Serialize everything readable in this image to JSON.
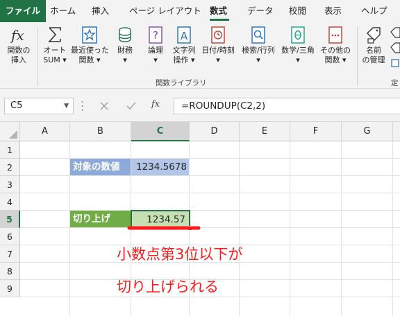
{
  "tabs": [
    "ファイル",
    "ホーム",
    "挿入",
    "ページ レイアウト",
    "数式",
    "データ",
    "校閲",
    "表示",
    "ヘルプ"
  ],
  "active_tab": "数式",
  "ribbon": {
    "buttons": [
      {
        "line1": "関数の",
        "line2": "挿入",
        "icon": "fx-icon"
      },
      {
        "line1": "オート",
        "line2": "SUM ▾",
        "icon": "sigma-icon"
      },
      {
        "line1": "最近使った",
        "line2": "関数 ▾",
        "icon": "star-icon"
      },
      {
        "line1": "財務",
        "line2": "▾",
        "icon": "coins-icon"
      },
      {
        "line1": "論理",
        "line2": "▾",
        "icon": "question-book-icon"
      },
      {
        "line1": "文字列",
        "line2": "操作 ▾",
        "icon": "text-book-icon"
      },
      {
        "line1": "日付/時刻",
        "line2": "▾",
        "icon": "clock-book-icon"
      },
      {
        "line1": "検索/行列",
        "line2": "▾",
        "icon": "search-book-icon"
      },
      {
        "line1": "数学/三角",
        "line2": "▾",
        "icon": "theta-book-icon"
      },
      {
        "line1": "その他の",
        "line2": "関数 ▾",
        "icon": "more-book-icon"
      },
      {
        "line1": "名前",
        "line2": "の管理",
        "icon": "name-tag-icon"
      }
    ],
    "group_label": "関数ライブラリ",
    "group_label_right": "定"
  },
  "formula_bar": {
    "name_box": "C5",
    "fx_label": "fx",
    "formula": "=ROUNDUP(C2,2)"
  },
  "columns": [
    "A",
    "B",
    "C",
    "D",
    "E",
    "F",
    "G"
  ],
  "selected_column": "C",
  "rows": [
    "1",
    "2",
    "3",
    "4",
    "5",
    "6",
    "7",
    "8",
    "9"
  ],
  "selected_row": "5",
  "cells": {
    "B2": "対象の数値",
    "C2": "1234.5678",
    "B5": "切り上げ",
    "C5": "1234.57"
  },
  "colors": {
    "excel_green": "#217346",
    "label_blue": "#8eaadb",
    "value_blue": "#b4c6e7",
    "label_green": "#70ad47",
    "value_green": "#c6e0b4",
    "annotation_red": "#ff1a1a"
  },
  "annotation": {
    "line1": "小数点第3位以下が",
    "line2": "切り上げられる"
  }
}
